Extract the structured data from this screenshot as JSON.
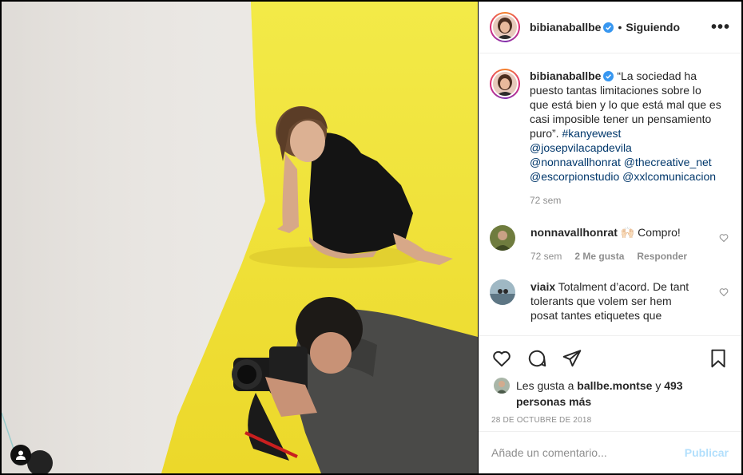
{
  "post": {
    "username": "bibianaballbe",
    "follow_status": "Siguiendo",
    "separator": "•",
    "more_label": "•••",
    "caption": {
      "username": "bibianaballbe",
      "text": "“La sociedad ha puesto tantas limitaciones sobre lo que está bien y lo que está mal que es casi imposible tener un pensamiento puro”.",
      "hashtag": "#kanyewest",
      "mentions": [
        "@josepvilacapdevila",
        "@nonnavallhonrat",
        "@thecreative_net",
        "@escorpionstudio",
        "@xxlcomunicacion"
      ],
      "time": "72 sem"
    },
    "comments": [
      {
        "username": "nonnavallhonrat",
        "text": "🙌🏻 Compro!",
        "time": "72 sem",
        "likes": "2 Me gusta",
        "reply": "Responder"
      },
      {
        "username": "viaix",
        "text": "Totalment d’acord. De tant tolerants que volem ser hem posat tantes etiquetes que"
      }
    ],
    "likes": {
      "prefix": "Les gusta a",
      "user": "ballbe.montse",
      "conj": "y",
      "count": "493 personas más"
    },
    "date": "28 DE OCTUBRE DE 2018",
    "comment_input": {
      "placeholder": "Añade un comentario...",
      "value": ""
    },
    "publish_label": "Publicar"
  },
  "icons": {
    "verified": "verified-badge-icon",
    "like": "heart-icon",
    "comment": "comment-bubble-icon",
    "share": "paper-plane-icon",
    "save": "bookmark-icon",
    "comment_like": "small-heart-icon",
    "user_tag": "user-tag-icon"
  },
  "colors": {
    "verified": "#3897f0",
    "link": "#00376b",
    "muted": "#8e8e8e",
    "publish_disabled": "#b2dffc",
    "backdrop_yellow": "#f1ea43"
  }
}
